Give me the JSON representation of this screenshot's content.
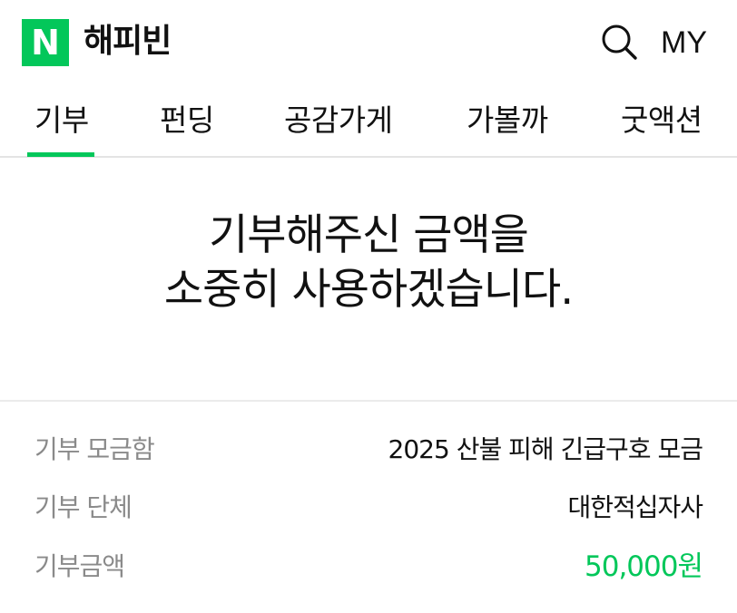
{
  "header": {
    "logo_letter": "N",
    "brand": "해피빈",
    "my_label": "MY",
    "search_icon": "search-icon"
  },
  "tabs": [
    {
      "label": "기부",
      "active": true
    },
    {
      "label": "펀딩",
      "active": false
    },
    {
      "label": "공감가게",
      "active": false
    },
    {
      "label": "가볼까",
      "active": false
    },
    {
      "label": "굿액션",
      "active": false
    }
  ],
  "thanks": {
    "line1": "기부해주신 금액을",
    "line2": "소중히 사용하겠습니다."
  },
  "details": [
    {
      "label": "기부 모금함",
      "value": "2025 산불 피해 긴급구호 모금"
    },
    {
      "label": "기부 단체",
      "value": "대한적십자사"
    },
    {
      "label": "기부금액",
      "value": "50,000원"
    }
  ],
  "colors": {
    "accent": "#03c75a",
    "label": "#8a8a8a",
    "text": "#111111"
  }
}
